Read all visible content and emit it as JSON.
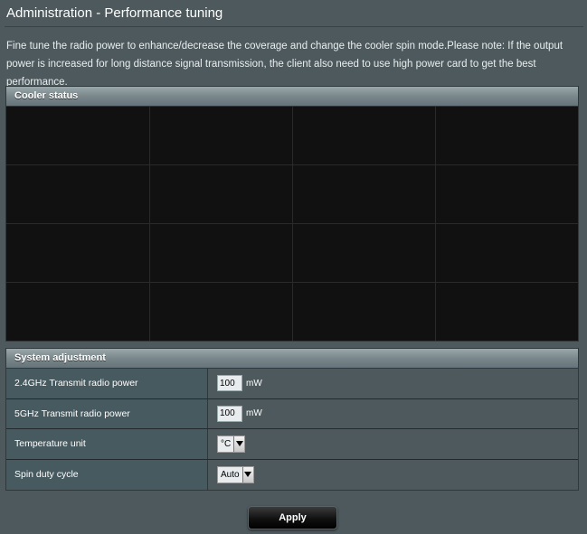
{
  "page": {
    "title": "Administration - Performance tuning",
    "description": "Fine tune the radio power to enhance/decrease the coverage and change the cooler spin mode.Please note: If the output power is increased for long distance signal transmission, the client also need to use high power card to get the best performance."
  },
  "cooler_status": {
    "header": "Cooler status"
  },
  "system_adjustment": {
    "header": "System adjustment",
    "rows": [
      {
        "label": "2.4GHz Transmit radio power",
        "value": "100",
        "unit": "mW"
      },
      {
        "label": "5GHz Transmit radio power",
        "value": "100",
        "unit": "mW"
      },
      {
        "label": "Temperature unit",
        "selected": "°C"
      },
      {
        "label": "Spin duty cycle",
        "selected": "Auto"
      }
    ]
  },
  "apply_label": "Apply",
  "colors": {
    "background": "#4d595d",
    "chart_bg": "#111111",
    "label_cell": "#475a60"
  }
}
